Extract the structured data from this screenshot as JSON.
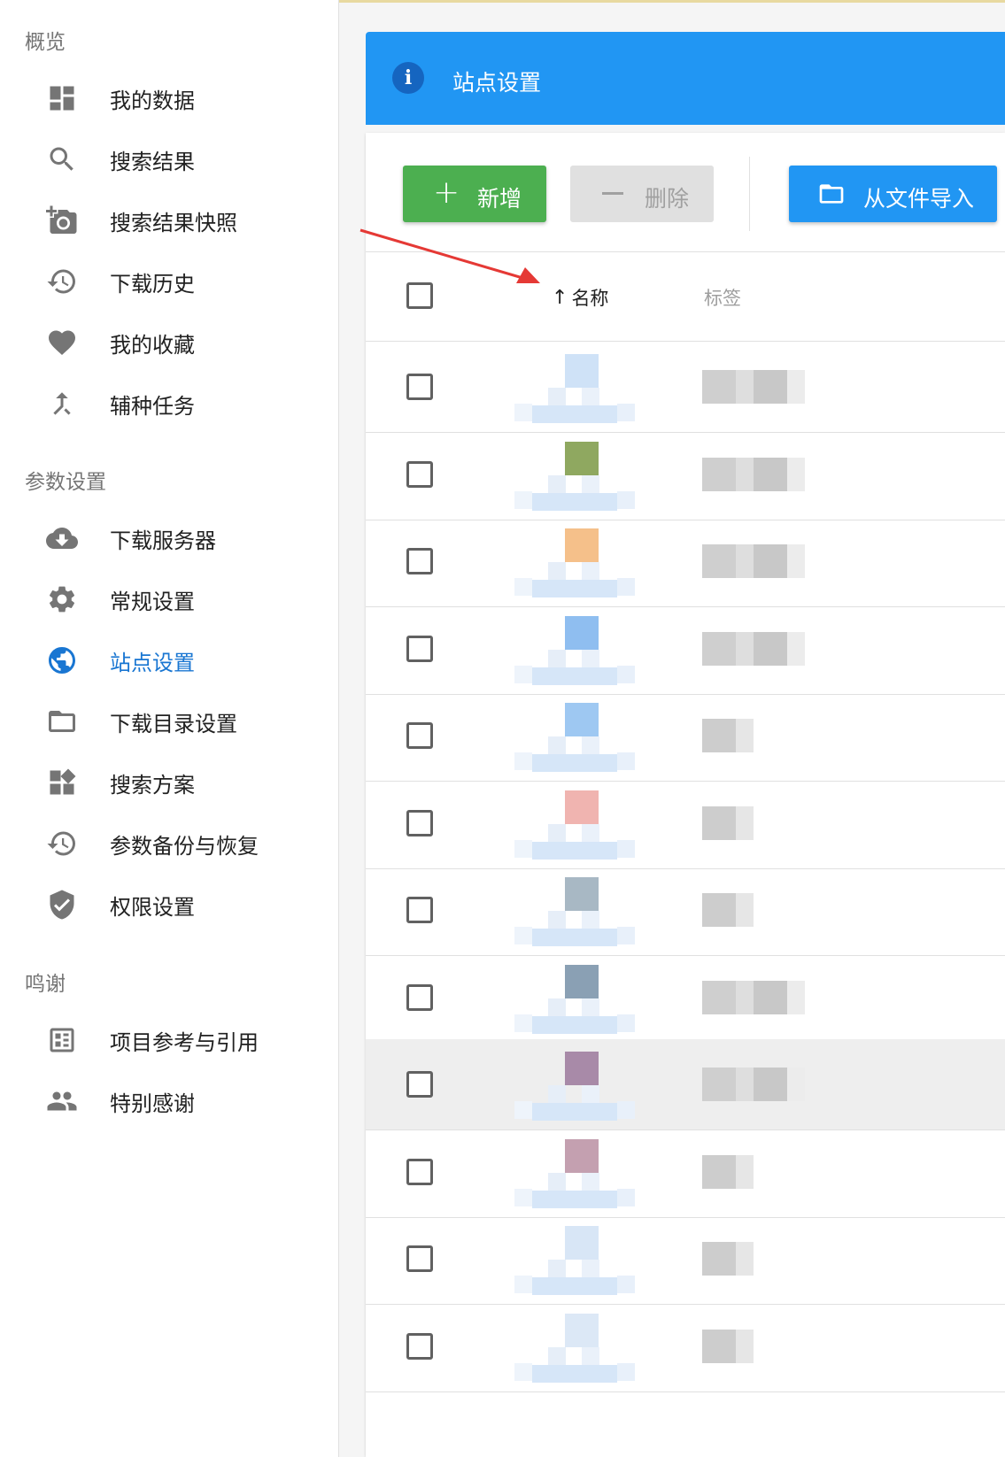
{
  "sidebar": {
    "sections": [
      {
        "title": "概览"
      },
      {
        "title": "参数设置"
      },
      {
        "title": "鸣谢"
      }
    ],
    "items": [
      {
        "label": "我的数据",
        "icon": "dashboard-icon"
      },
      {
        "label": "搜索结果",
        "icon": "search-icon"
      },
      {
        "label": "搜索结果快照",
        "icon": "add-camera-icon"
      },
      {
        "label": "下载历史",
        "icon": "history-icon"
      },
      {
        "label": "我的收藏",
        "icon": "heart-icon"
      },
      {
        "label": "辅种任务",
        "icon": "merge-icon"
      },
      {
        "label": "下载服务器",
        "icon": "cloud-download-icon"
      },
      {
        "label": "常规设置",
        "icon": "gear-icon"
      },
      {
        "label": "站点设置",
        "icon": "globe-icon",
        "active": true
      },
      {
        "label": "下载目录设置",
        "icon": "folder-icon"
      },
      {
        "label": "搜索方案",
        "icon": "widgets-icon"
      },
      {
        "label": "参数备份与恢复",
        "icon": "restore-icon"
      },
      {
        "label": "权限设置",
        "icon": "shield-check-icon"
      },
      {
        "label": "项目参考与引用",
        "icon": "reference-icon"
      },
      {
        "label": "特别感谢",
        "icon": "people-icon"
      }
    ]
  },
  "banner": {
    "title": "站点设置",
    "icon": "info-icon"
  },
  "toolbar": {
    "add_label": "新增",
    "delete_label": "删除",
    "import_label": "从文件导入"
  },
  "table": {
    "columns": {
      "name": "名称",
      "tag": "标签"
    },
    "sort_indicator": "↑",
    "row_count": 12,
    "highlighted_row": 8
  },
  "colors": {
    "primary": "#2196f3",
    "success": "#4caf50",
    "active_nav": "#1976d2",
    "annotation": "#e53935"
  }
}
